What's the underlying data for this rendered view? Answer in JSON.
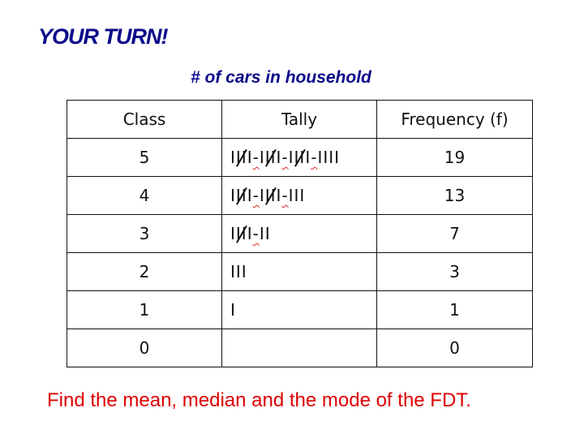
{
  "title": "YOUR TURN!",
  "table_caption": "# of cars in household",
  "table": {
    "headers": [
      "Class",
      "Tally",
      "Frequency (f)"
    ],
    "rows": [
      {
        "class": "5",
        "tally": "IIII-IIII-IIII-IIII",
        "frequency": "19"
      },
      {
        "class": "4",
        "tally": "IIII-IIII-III",
        "frequency": "13"
      },
      {
        "class": "3",
        "tally": "IIII-II",
        "frequency": "7"
      },
      {
        "class": "2",
        "tally": "III",
        "frequency": "3"
      },
      {
        "class": "1",
        "tally": "I",
        "frequency": "1"
      },
      {
        "class": "0",
        "tally": "",
        "frequency": "0"
      }
    ]
  },
  "instruction": "Find the mean, median and the mode of the FDT.",
  "colors": {
    "title": "#0a0a8a",
    "instruction": "#dd0000",
    "spellcheck_underline": "#dd2222"
  }
}
